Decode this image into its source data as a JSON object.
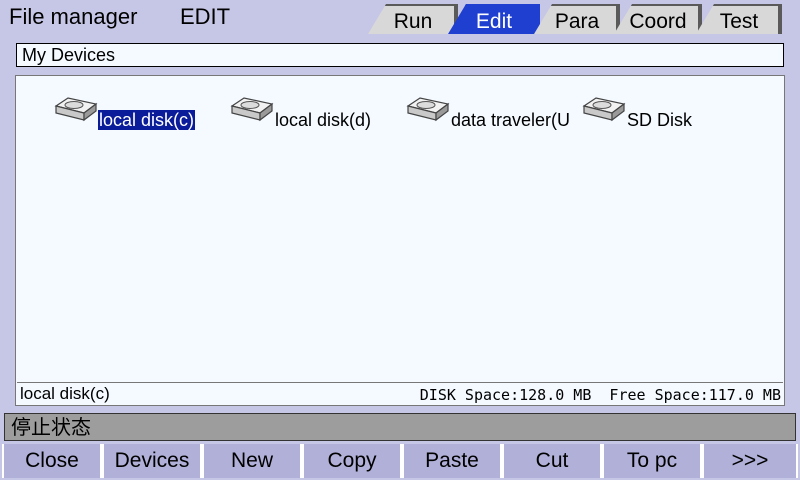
{
  "header": {
    "title": "File manager",
    "mode": "EDIT"
  },
  "tabs": [
    {
      "label": "Run",
      "active": false
    },
    {
      "label": "Edit",
      "active": true
    },
    {
      "label": "Para",
      "active": false
    },
    {
      "label": "Coord",
      "active": false
    },
    {
      "label": "Test",
      "active": false
    }
  ],
  "path": {
    "value": "My Devices"
  },
  "devices": [
    {
      "label": "local disk(c)",
      "icon": "hard-disk-icon",
      "selected": true
    },
    {
      "label": "local disk(d)",
      "icon": "hard-disk-icon",
      "selected": false
    },
    {
      "label": "data traveler(U",
      "icon": "hard-disk-icon",
      "selected": false
    },
    {
      "label": "SD Disk",
      "icon": "hard-disk-icon",
      "selected": false
    }
  ],
  "status": {
    "selected_name": "local disk(c)",
    "space_text": "DISK Space:128.0 MB  Free Space:117.0 MB"
  },
  "message": {
    "text": "停止状态"
  },
  "buttons": [
    {
      "label": "Close"
    },
    {
      "label": "Devices"
    },
    {
      "label": "New"
    },
    {
      "label": "Copy"
    },
    {
      "label": "Paste"
    },
    {
      "label": "Cut"
    },
    {
      "label": "To pc"
    },
    {
      "label": ">>>"
    }
  ],
  "colors": {
    "background": "#c6c6e6",
    "active_tab": "#1f3fd0",
    "selection": "#0a1c9a",
    "message_bar": "#9d9d9d",
    "button": "#b0b0d8"
  }
}
